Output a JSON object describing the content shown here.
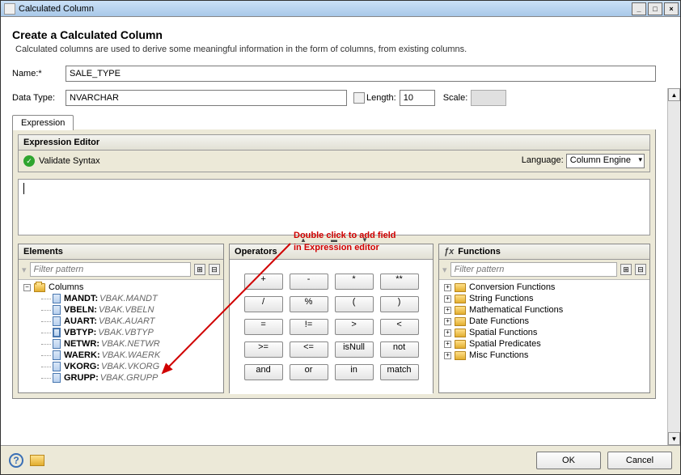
{
  "window": {
    "title": "Calculated Column"
  },
  "header": {
    "title": "Create a Calculated Column",
    "desc": "Calculated columns are used to derive some meaningful information in the form of columns, from existing columns."
  },
  "form": {
    "name_label": "Name:*",
    "name_value": "SALE_TYPE",
    "datatype_label": "Data Type:",
    "datatype_value": "NVARCHAR",
    "length_label": "Length:",
    "length_value": "10",
    "scale_label": "Scale:",
    "scale_value": ""
  },
  "tabs": {
    "expression": "Expression"
  },
  "expr_editor": {
    "head": "Expression Editor",
    "validate": "Validate Syntax",
    "lang_label": "Language:",
    "lang_value": "Column Engine"
  },
  "annotation": {
    "line1": "Double click to add field",
    "line2": "in Expression editor"
  },
  "elements": {
    "title": "Elements",
    "filter_placeholder": "Filter pattern",
    "root": "Columns",
    "items": [
      {
        "name": "MANDT",
        "alias": "VBAK.MANDT",
        "bold": false
      },
      {
        "name": "VBELN",
        "alias": "VBAK.VBELN",
        "bold": false
      },
      {
        "name": "AUART",
        "alias": "VBAK.AUART",
        "bold": false
      },
      {
        "name": "VBTYP",
        "alias": "VBAK.VBTYP",
        "bold": true
      },
      {
        "name": "NETWR",
        "alias": "VBAK.NETWR",
        "bold": false
      },
      {
        "name": "WAERK",
        "alias": "VBAK.WAERK",
        "bold": false
      },
      {
        "name": "VKORG",
        "alias": "VBAK.VKORG",
        "bold": false
      },
      {
        "name": "GRUPP",
        "alias": "VBAK.GRUPP",
        "bold": false
      }
    ]
  },
  "operators": {
    "title": "Operators",
    "rows": [
      [
        "+",
        "-",
        "*",
        "**"
      ],
      [
        "/",
        "%",
        "(",
        ")"
      ],
      [
        "=",
        "!=",
        ">",
        "<"
      ],
      [
        ">=",
        "<=",
        "isNull",
        "not"
      ],
      [
        "and",
        "or",
        "in",
        "match"
      ]
    ]
  },
  "functions": {
    "title": "Functions",
    "filter_placeholder": "Filter pattern",
    "items": [
      "Conversion Functions",
      "String Functions",
      "Mathematical Functions",
      "Date Functions",
      "Spatial Functions",
      "Spatial Predicates",
      "Misc Functions"
    ]
  },
  "footer": {
    "ok": "OK",
    "cancel": "Cancel"
  }
}
